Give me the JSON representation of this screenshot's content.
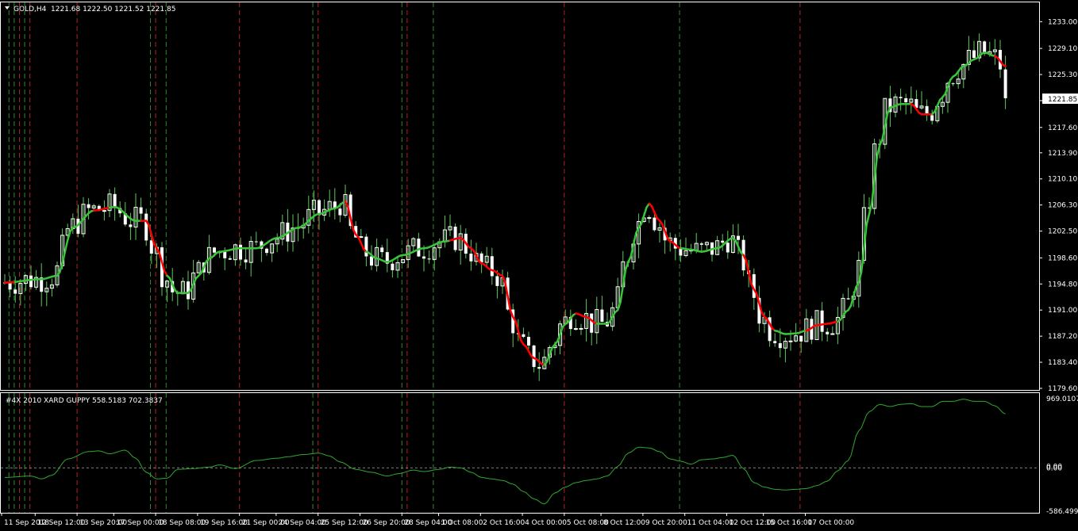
{
  "header": {
    "symbol": "GOLD,H4",
    "ohlc": "1221.68 1222.50 1221.52 1221.85"
  },
  "indicator": {
    "label": "#4X 2010 XARD GUPPY 558.5183 702.3837"
  },
  "colors": {
    "bg": "#000000",
    "frame": "#ffffff",
    "text": "#ffffff",
    "bull": "#ffffff",
    "bear": "#ffffff",
    "wick": "#5ec75e",
    "ma_up": "#3ac43a",
    "ma_down": "#ff0000",
    "vline_green": "#2e8b2e",
    "vline_red": "#b22222",
    "osc": "#2ea82e",
    "zero": "#808080"
  },
  "chart_data": [
    {
      "type": "candlestick",
      "symbol": "GOLD",
      "timeframe": "H4",
      "ylim": [
        1179.6,
        1235.0
      ],
      "yticks": [
        "1233.00",
        "1229.10",
        "1225.30",
        "1221.50",
        "1217.60",
        "1213.90",
        "1210.10",
        "1206.30",
        "1202.50",
        "1198.60",
        "1194.80",
        "1191.00",
        "1187.20",
        "1183.40",
        "1179.60"
      ],
      "last_price": "1221.85",
      "xticks": [
        "11 Sep 2018",
        "12 Sep 12:00",
        "13 Sep 20:00",
        "17 Sep 00:00",
        "18 Sep 08:00",
        "19 Sep 16:00",
        "21 Sep 00:00",
        "24 Sep 04:00",
        "25 Sep 12:00",
        "26 Sep 20:00",
        "28 Sep 04:00",
        "1 Oct 08:00",
        "2 Oct 16:00",
        "4 Oct 00:00",
        "5 Oct 08:00",
        "8 Oct 12:00",
        "9 Oct 20:00",
        "11 Oct 04:00",
        "12 Oct 12:00",
        "15 Oct 16:00",
        "17 Oct 00:00"
      ],
      "ma_knots": [
        [
          0,
          1195.0
        ],
        [
          7,
          1195.5
        ],
        [
          10,
          1196.0
        ],
        [
          13,
          1203.0
        ],
        [
          17,
          1205.5
        ],
        [
          21,
          1206.0
        ],
        [
          25,
          1204.0
        ],
        [
          27,
          1204.0
        ],
        [
          29,
          1200.0
        ],
        [
          31,
          1196.0
        ],
        [
          33,
          1193.5
        ],
        [
          35,
          1193.5
        ],
        [
          37,
          1196.0
        ],
        [
          39,
          1198.5
        ],
        [
          41,
          1199.5
        ],
        [
          45,
          1200.0
        ],
        [
          48,
          1200.0
        ],
        [
          52,
          1201.5
        ],
        [
          56,
          1203.0
        ],
        [
          60,
          1205.0
        ],
        [
          63,
          1205.8
        ],
        [
          65,
          1206.8
        ],
        [
          67,
          1202.0
        ],
        [
          69,
          1199.5
        ],
        [
          71,
          1198.5
        ],
        [
          73,
          1198.0
        ],
        [
          76,
          1199.0
        ],
        [
          80,
          1200.0
        ],
        [
          84,
          1201.0
        ],
        [
          87,
          1201.5
        ],
        [
          89,
          1200.0
        ],
        [
          91,
          1197.8
        ],
        [
          93,
          1196.8
        ],
        [
          95,
          1196.0
        ],
        [
          97,
          1190.0
        ],
        [
          99,
          1186.0
        ],
        [
          101,
          1184.0
        ],
        [
          103,
          1183.0
        ],
        [
          105,
          1186.0
        ],
        [
          107,
          1189.0
        ],
        [
          109,
          1190.5
        ],
        [
          111,
          1190.0
        ],
        [
          113,
          1189.0
        ],
        [
          115,
          1189.0
        ],
        [
          117,
          1191.0
        ],
        [
          119,
          1198.0
        ],
        [
          121,
          1203.0
        ],
        [
          123,
          1206.5
        ],
        [
          125,
          1204.0
        ],
        [
          127,
          1201.0
        ],
        [
          129,
          1200.0
        ],
        [
          131,
          1199.8
        ],
        [
          133,
          1199.5
        ],
        [
          136,
          1200.0
        ],
        [
          139,
          1201.5
        ],
        [
          141,
          1199.0
        ],
        [
          143,
          1194.0
        ],
        [
          145,
          1190.0
        ],
        [
          147,
          1188.0
        ],
        [
          149,
          1187.5
        ],
        [
          151,
          1187.6
        ],
        [
          153,
          1188.0
        ],
        [
          155,
          1188.8
        ],
        [
          157,
          1189.0
        ],
        [
          159,
          1189.3
        ],
        [
          161,
          1191.0
        ],
        [
          163,
          1195.0
        ],
        [
          165,
          1205.0
        ],
        [
          167,
          1215.0
        ],
        [
          169,
          1220.5
        ],
        [
          171,
          1221.0
        ],
        [
          173,
          1221.0
        ],
        [
          175,
          1219.5
        ],
        [
          177,
          1219.5
        ],
        [
          179,
          1222.0
        ],
        [
          181,
          1225.0
        ],
        [
          183,
          1226.5
        ],
        [
          185,
          1227.5
        ],
        [
          187,
          1228.5
        ],
        [
          189,
          1228.0
        ],
        [
          191,
          1226.5
        ]
      ],
      "ma_down_ranges": [
        [
          0,
          2
        ],
        [
          17,
          20
        ],
        [
          26,
          31
        ],
        [
          65,
          69
        ],
        [
          85,
          103
        ],
        [
          109,
          113
        ],
        [
          123,
          129
        ],
        [
          141,
          147
        ],
        [
          153,
          159
        ],
        [
          173,
          177
        ],
        [
          189,
          191
        ]
      ],
      "vlines": [
        {
          "x": "11 Sep 16:00",
          "color": "green"
        },
        {
          "x": "11 Sep 20:00",
          "color": "green"
        },
        {
          "x": "12 Sep 00:00",
          "color": "red"
        },
        {
          "x": "12 Sep 04:00",
          "color": "green"
        },
        {
          "x": "12 Sep 08:00",
          "color": "red"
        },
        {
          "x": "13 Sep 20:00",
          "color": "red"
        },
        {
          "x": "18 Sep 04:00",
          "color": "green"
        },
        {
          "x": "18 Sep 08:00",
          "color": "red"
        },
        {
          "x": "18 Sep 16:00",
          "color": "green"
        },
        {
          "x": "21 Sep 00:00",
          "color": "red"
        },
        {
          "x": "25 Sep 08:00",
          "color": "green"
        },
        {
          "x": "25 Sep 12:00",
          "color": "red"
        },
        {
          "x": "28 Sep 04:00",
          "color": "green"
        },
        {
          "x": "28 Sep 08:00",
          "color": "red"
        },
        {
          "x": "1 Oct 04:00",
          "color": "green"
        },
        {
          "x": "5 Oct 08:00",
          "color": "red"
        },
        {
          "x": "11 Oct 00:00",
          "color": "green"
        },
        {
          "x": "16 Oct 20:00",
          "color": "red"
        }
      ]
    },
    {
      "type": "line",
      "name": "#4X 2010 XARD GUPPY",
      "values_text": "558.5183 702.3837",
      "ylim": [
        -586.4993,
        969.0107
      ],
      "yticks": [
        "969.0107",
        "0.00",
        "0.00",
        "-586.4993"
      ],
      "knots": [
        [
          0,
          -130
        ],
        [
          5,
          -110
        ],
        [
          7,
          -150
        ],
        [
          9,
          -100
        ],
        [
          12,
          120
        ],
        [
          16,
          220
        ],
        [
          18,
          230
        ],
        [
          20,
          190
        ],
        [
          23,
          240
        ],
        [
          25,
          130
        ],
        [
          27,
          -60
        ],
        [
          29,
          -150
        ],
        [
          31,
          -140
        ],
        [
          33,
          -20
        ],
        [
          36,
          -10
        ],
        [
          39,
          10
        ],
        [
          41,
          40
        ],
        [
          44,
          -10
        ],
        [
          48,
          100
        ],
        [
          52,
          130
        ],
        [
          54,
          150
        ],
        [
          57,
          180
        ],
        [
          60,
          200
        ],
        [
          62,
          160
        ],
        [
          64,
          80
        ],
        [
          67,
          -20
        ],
        [
          70,
          -60
        ],
        [
          73,
          -110
        ],
        [
          75,
          -80
        ],
        [
          78,
          -30
        ],
        [
          80,
          -50
        ],
        [
          83,
          -20
        ],
        [
          85,
          10
        ],
        [
          87,
          0
        ],
        [
          89,
          -60
        ],
        [
          91,
          -130
        ],
        [
          93,
          -150
        ],
        [
          95,
          -170
        ],
        [
          97,
          -220
        ],
        [
          99,
          -320
        ],
        [
          101,
          -420
        ],
        [
          103,
          -490
        ],
        [
          105,
          -340
        ],
        [
          107,
          -260
        ],
        [
          109,
          -200
        ],
        [
          111,
          -170
        ],
        [
          113,
          -150
        ],
        [
          115,
          -110
        ],
        [
          117,
          20
        ],
        [
          119,
          200
        ],
        [
          121,
          280
        ],
        [
          123,
          270
        ],
        [
          125,
          220
        ],
        [
          127,
          120
        ],
        [
          129,
          90
        ],
        [
          131,
          50
        ],
        [
          133,
          110
        ],
        [
          135,
          120
        ],
        [
          137,
          140
        ],
        [
          139,
          170
        ],
        [
          141,
          -10
        ],
        [
          143,
          -200
        ],
        [
          145,
          -260
        ],
        [
          147,
          -290
        ],
        [
          149,
          -300
        ],
        [
          151,
          -290
        ],
        [
          153,
          -280
        ],
        [
          155,
          -240
        ],
        [
          157,
          -180
        ],
        [
          159,
          -40
        ],
        [
          161,
          100
        ],
        [
          163,
          500
        ],
        [
          165,
          760
        ],
        [
          167,
          860
        ],
        [
          169,
          830
        ],
        [
          171,
          860
        ],
        [
          173,
          870
        ],
        [
          175,
          830
        ],
        [
          177,
          830
        ],
        [
          179,
          900
        ],
        [
          181,
          900
        ],
        [
          183,
          930
        ],
        [
          185,
          900
        ],
        [
          187,
          900
        ],
        [
          189,
          840
        ],
        [
          191,
          730
        ]
      ]
    }
  ]
}
